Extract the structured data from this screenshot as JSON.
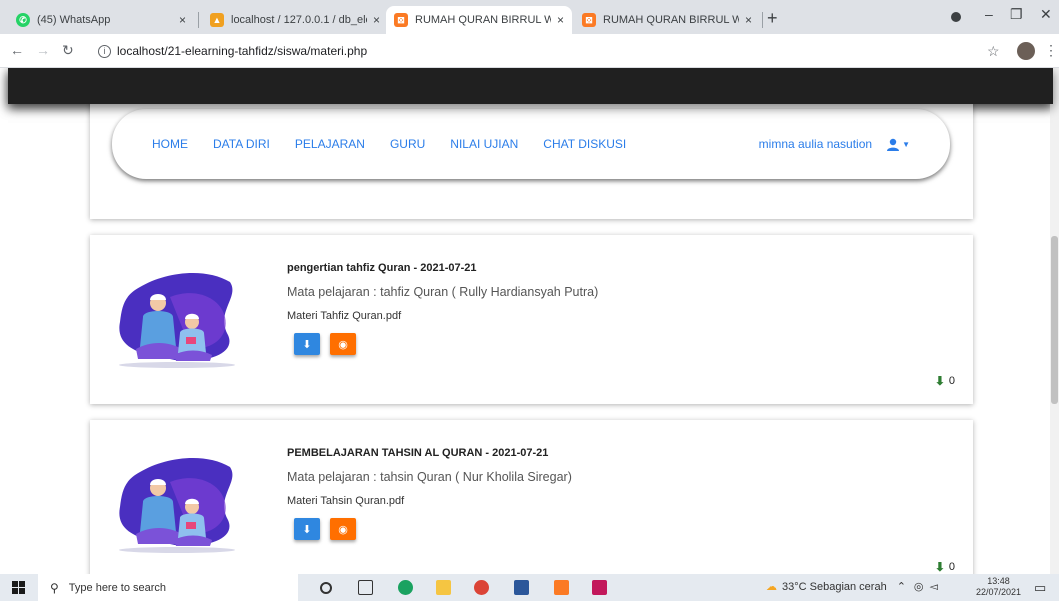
{
  "browser": {
    "tabs": [
      {
        "title": "(45) WhatsApp",
        "icon": "whatsapp-icon",
        "color": "#25d366"
      },
      {
        "title": "localhost / 127.0.0.1 / db_elearni",
        "icon": "phpmyadmin-icon",
        "color": "#f0a020"
      },
      {
        "title": "RUMAH QURAN BIRRUL WALIDA",
        "icon": "xampp-icon",
        "color": "#fb7a24"
      },
      {
        "title": "RUMAH QURAN BIRRUL WALIDA",
        "icon": "xampp-icon",
        "color": "#fb7a24"
      }
    ],
    "url": "localhost/21-elearning-tahfidz/siswa/materi.php"
  },
  "navbar": {
    "links": [
      "HOME",
      "DATA DIRI",
      "PELAJARAN",
      "GURU",
      "NILAI UJIAN",
      "CHAT DISKUSI"
    ],
    "user_name": "mimna aulia nasution",
    "accent": "#2b7de9"
  },
  "materials": [
    {
      "title": "pengertian tahfiz Quran - 2021-07-21",
      "subject": "Mata pelajaran : tahfiz Quran ( Rully Hardiansyah Putra)",
      "file": "Materi Tahfiz Quran.pdf",
      "downloads": "0"
    },
    {
      "title": "PEMBELAJARAN TAHSIN AL QURAN - 2021-07-21",
      "subject": "Mata pelajaran : tahsin Quran ( Nur Kholila Siregar)",
      "file": "Materi Tahsin Quran.pdf",
      "downloads": "0"
    }
  ],
  "taskbar": {
    "search_placeholder": "Type here to search",
    "weather": "33°C  Sebagian cerah",
    "time": "13:48",
    "date": "22/07/2021"
  }
}
